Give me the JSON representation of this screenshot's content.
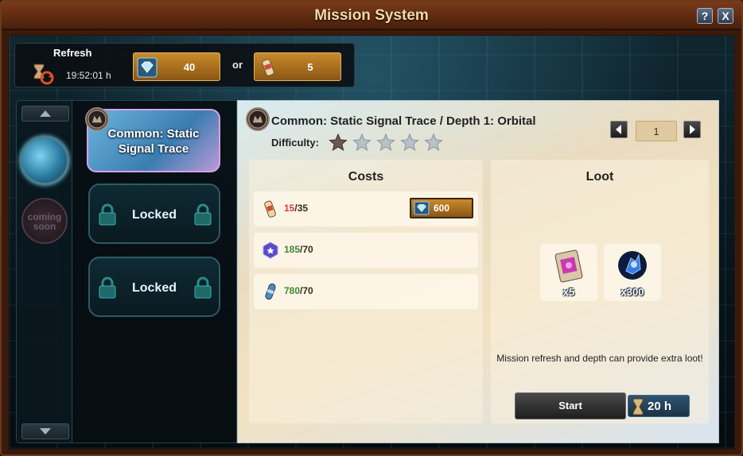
{
  "window": {
    "title": "Mission System",
    "help_label": "?",
    "close_label": "X"
  },
  "refresh": {
    "label": "Refresh",
    "timer": "19:52:01 h",
    "option_a": {
      "icon": "diamond-icon",
      "value": "40"
    },
    "or_label": "or",
    "option_b": {
      "icon": "scroll-icon",
      "value": "5"
    }
  },
  "rail": {
    "coming_soon": "coming soon"
  },
  "missions": [
    {
      "label": "Common: Static Signal Trace",
      "state": "active"
    },
    {
      "label": "Locked",
      "state": "locked"
    },
    {
      "label": "Locked",
      "state": "locked"
    }
  ],
  "detail": {
    "title": "Common: Static Signal Trace / Depth 1: Orbital",
    "difficulty_label": "Difficulty:",
    "difficulty_filled": 1,
    "difficulty_max": 5,
    "depth_value": "1"
  },
  "costs": {
    "heading": "Costs",
    "rows": [
      {
        "icon": "scroll-icon",
        "have": "15",
        "need": "/35",
        "have_color": "red"
      },
      {
        "icon": "hexagon-token-icon",
        "have": "185",
        "need": "/70",
        "have_color": "green"
      },
      {
        "icon": "capsule-icon",
        "have": "780",
        "need": "/70",
        "have_color": "green"
      }
    ],
    "buy": {
      "icon": "diamond-icon",
      "value": "600"
    }
  },
  "loot": {
    "heading": "Loot",
    "items": [
      {
        "icon": "data-card-icon",
        "qty": "x5"
      },
      {
        "icon": "blue-crystal-icon",
        "qty": "x300"
      }
    ],
    "note": "Mission refresh and depth can provide extra loot!"
  },
  "actions": {
    "start_label": "Start",
    "duration": "20 h"
  },
  "colors": {
    "frame": "#3b1a0c",
    "title_text": "#f3d9a6",
    "gold": "#c98a2a",
    "cost_red": "#e23a3a",
    "cost_green": "#3c8a32"
  }
}
